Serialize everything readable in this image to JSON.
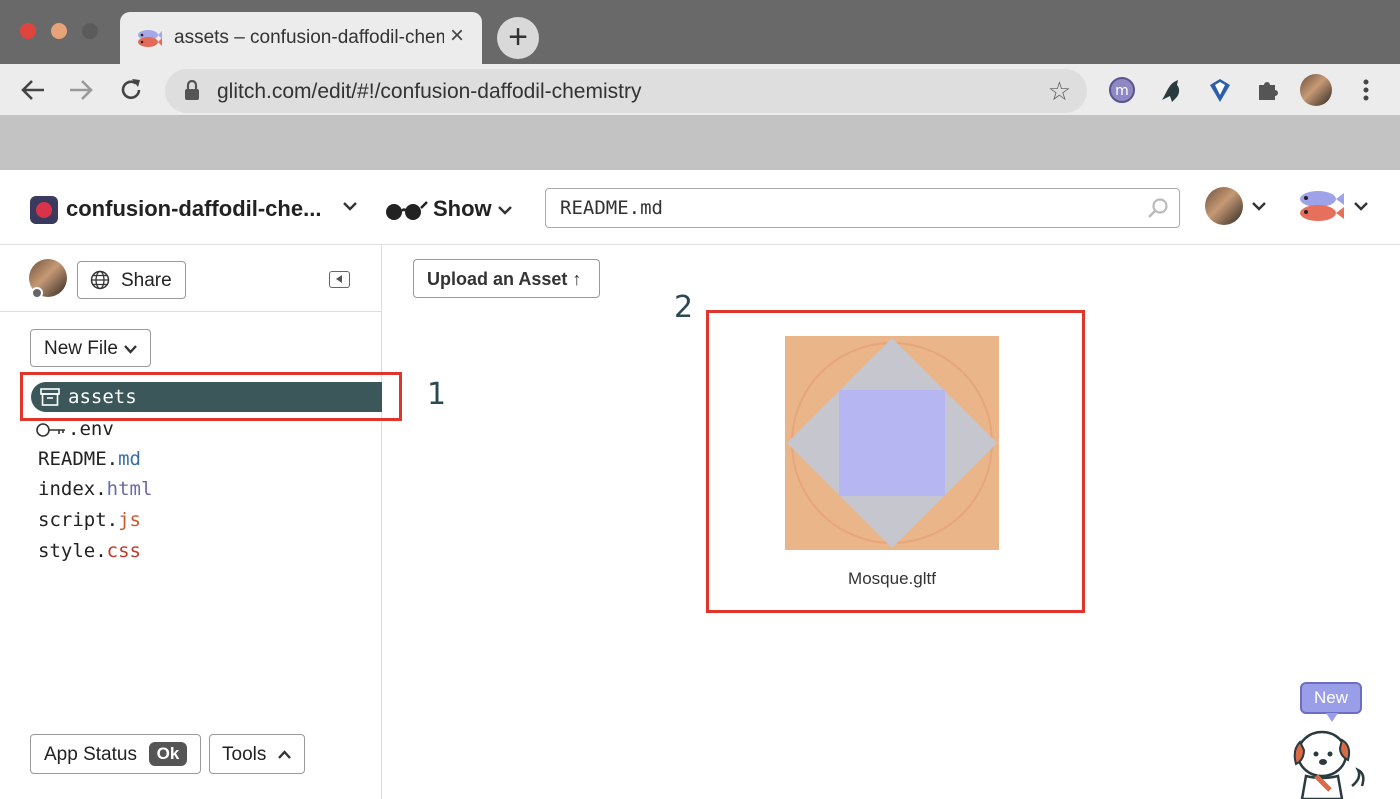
{
  "browser": {
    "tab_title": "assets – confusion-daffodil-chemistry",
    "tab_close": "×",
    "new_tab": "+",
    "url": "glitch.com/edit/#!/confusion-daffodil-chemistry",
    "icons": [
      "back-icon",
      "forward-icon",
      "reload-icon",
      "lock-icon",
      "star-icon",
      "extension-m-icon",
      "extension-bird-icon",
      "extension-diamond-icon",
      "extensions-puzzle-icon",
      "profile-avatar",
      "more-menu-icon"
    ]
  },
  "header": {
    "project_name": "confusion-daffodil-che...",
    "show_label": "Show",
    "search_value": "README.md"
  },
  "sidebar": {
    "share_label": "Share",
    "new_file_label": "New File",
    "files": [
      {
        "name": "assets",
        "ext": ""
      },
      {
        "name": ".env",
        "ext": ""
      },
      {
        "name": "README.",
        "ext": "md"
      },
      {
        "name": "index.",
        "ext": "html"
      },
      {
        "name": "script.",
        "ext": "js"
      },
      {
        "name": "style.",
        "ext": "css"
      }
    ],
    "app_status_label": "App Status",
    "app_status_value": "Ok",
    "tools_label": "Tools"
  },
  "main": {
    "upload_label": "Upload an Asset ↑",
    "asset_name": "Mosque.gltf",
    "new_badge": "New"
  },
  "annotations": {
    "one": "1",
    "two": "2"
  },
  "colors": {
    "accent_dark_teal": "#3b575a",
    "annotation_red": "#e0352b",
    "asset_orange": "#e9b589",
    "asset_grey": "#c6c6cf",
    "asset_purple": "#b6b6f2"
  }
}
